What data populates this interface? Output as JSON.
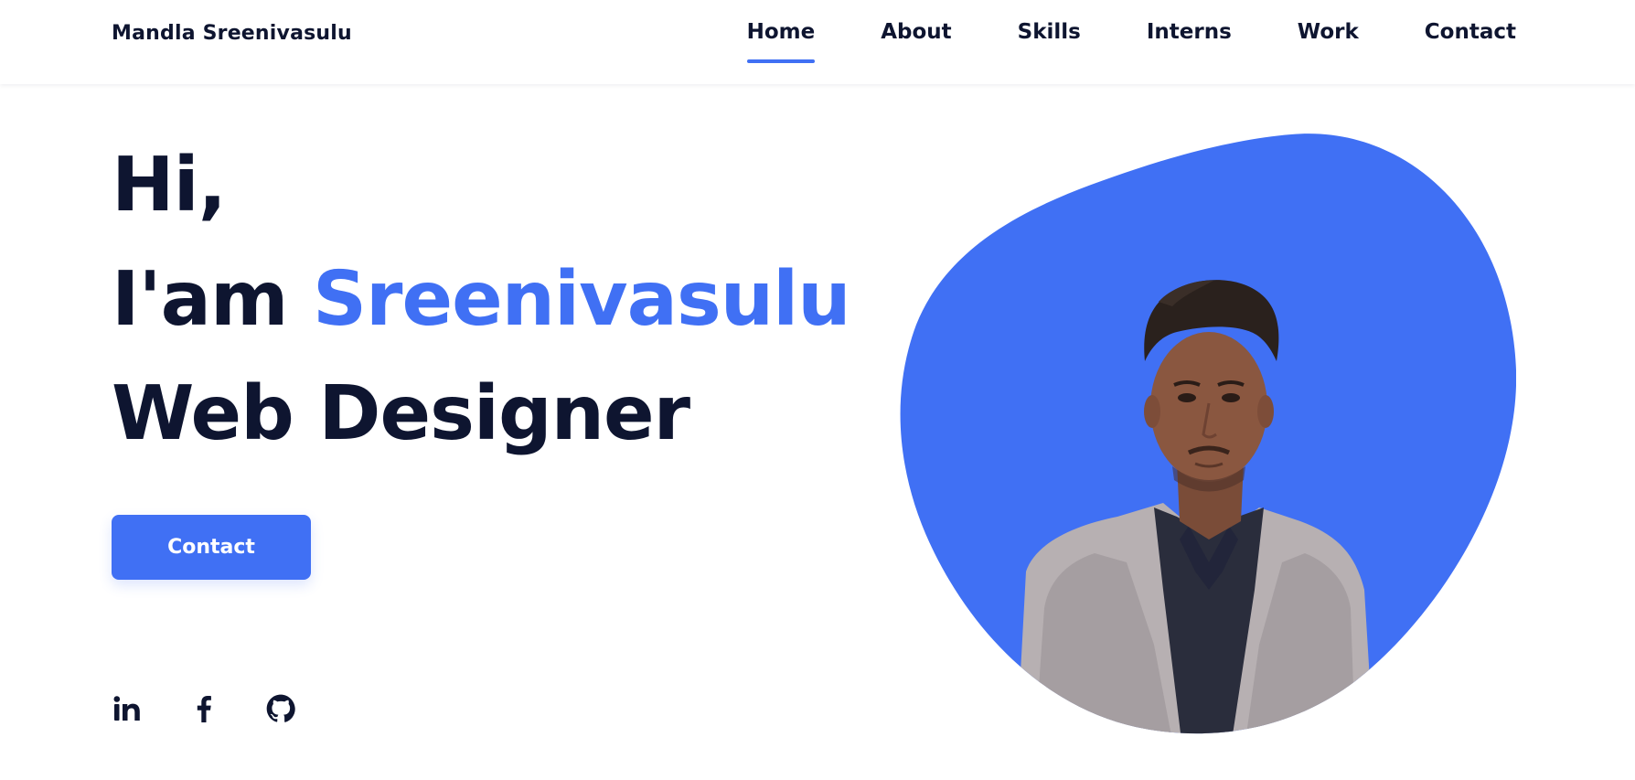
{
  "header": {
    "logo": "Mandla Sreenivasulu",
    "nav": [
      {
        "label": "Home",
        "active": true
      },
      {
        "label": "About"
      },
      {
        "label": "Skills"
      },
      {
        "label": "Interns"
      },
      {
        "label": "Work"
      },
      {
        "label": "Contact"
      }
    ]
  },
  "hero": {
    "line1": "Hi,",
    "line2_prefix": "I'am ",
    "line2_name": "Sreenivasulu",
    "line3": "Web Designer",
    "button_label": "Contact"
  },
  "socials": [
    {
      "icon": "linkedin-icon"
    },
    {
      "icon": "facebook-icon"
    },
    {
      "icon": "github-icon"
    }
  ],
  "profile": {
    "image": "portrait-photo"
  },
  "colors": {
    "accent": "#4070f4",
    "text": "#0e1530",
    "background": "#ffffff"
  }
}
